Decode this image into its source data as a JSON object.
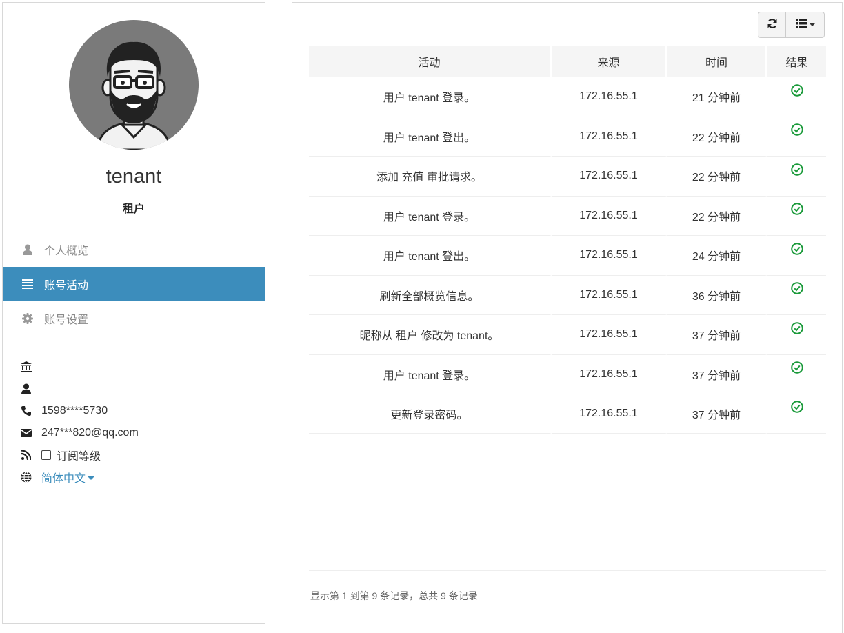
{
  "profile": {
    "username": "tenant",
    "role": "租户"
  },
  "nav": {
    "items": [
      {
        "label": "个人概览",
        "icon": "user-icon",
        "active": false
      },
      {
        "label": "账号活动",
        "icon": "list-icon",
        "active": true
      },
      {
        "label": "账号设置",
        "icon": "gear-icon",
        "active": false
      }
    ]
  },
  "info": {
    "institution_icon": "bank-icon",
    "person_icon": "user-icon",
    "phone": "1598****5730",
    "email": "247***820@qq.com",
    "subscribe_label": "订阅等级",
    "language": "简体中文"
  },
  "table": {
    "headers": [
      "活动",
      "来源",
      "时间",
      "结果"
    ],
    "rows": [
      {
        "activity": "用户 tenant 登录。",
        "source": "172.16.55.1",
        "time": "21 分钟前",
        "result": "success"
      },
      {
        "activity": "用户 tenant 登出。",
        "source": "172.16.55.1",
        "time": "22 分钟前",
        "result": "success"
      },
      {
        "activity": "添加 充值 审批请求。",
        "source": "172.16.55.1",
        "time": "22 分钟前",
        "result": "success"
      },
      {
        "activity": "用户 tenant 登录。",
        "source": "172.16.55.1",
        "time": "22 分钟前",
        "result": "success"
      },
      {
        "activity": "用户 tenant 登出。",
        "source": "172.16.55.1",
        "time": "24 分钟前",
        "result": "success"
      },
      {
        "activity": "刷新全部概览信息。",
        "source": "172.16.55.1",
        "time": "36 分钟前",
        "result": "success"
      },
      {
        "activity": "昵称从 租户 修改为 tenant。",
        "source": "172.16.55.1",
        "time": "37 分钟前",
        "result": "success"
      },
      {
        "activity": "用户 tenant 登录。",
        "source": "172.16.55.1",
        "time": "37 分钟前",
        "result": "success"
      },
      {
        "activity": "更新登录密码。",
        "source": "172.16.55.1",
        "time": "37 分钟前",
        "result": "success"
      }
    ]
  },
  "pagination": {
    "info": "显示第 1 到第 9 条记录，总共 9 条记录"
  },
  "colors": {
    "accent": "#3c8dbc",
    "success": "#1a9a3a"
  }
}
